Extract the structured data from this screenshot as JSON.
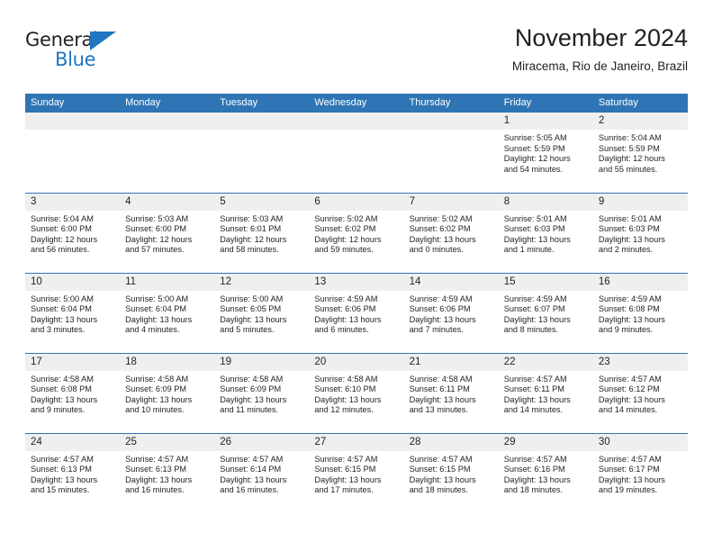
{
  "brand": {
    "name_top": "General",
    "name_bottom": "Blue",
    "accent_color": "#1f76c2"
  },
  "header": {
    "title": "November 2024",
    "subtitle": "Miracema, Rio de Janeiro, Brazil"
  },
  "theme": {
    "header_blue": "#2f75b5",
    "daynum_gray": "#efefef",
    "text": "#231f20"
  },
  "weekday_headers": [
    "Sunday",
    "Monday",
    "Tuesday",
    "Wednesday",
    "Thursday",
    "Friday",
    "Saturday"
  ],
  "weeks": [
    [
      {
        "day": "",
        "lines": []
      },
      {
        "day": "",
        "lines": []
      },
      {
        "day": "",
        "lines": []
      },
      {
        "day": "",
        "lines": []
      },
      {
        "day": "",
        "lines": []
      },
      {
        "day": "1",
        "lines": [
          "Sunrise: 5:05 AM",
          "Sunset: 5:59 PM",
          "Daylight: 12 hours",
          "and 54 minutes."
        ]
      },
      {
        "day": "2",
        "lines": [
          "Sunrise: 5:04 AM",
          "Sunset: 5:59 PM",
          "Daylight: 12 hours",
          "and 55 minutes."
        ]
      }
    ],
    [
      {
        "day": "3",
        "lines": [
          "Sunrise: 5:04 AM",
          "Sunset: 6:00 PM",
          "Daylight: 12 hours",
          "and 56 minutes."
        ]
      },
      {
        "day": "4",
        "lines": [
          "Sunrise: 5:03 AM",
          "Sunset: 6:00 PM",
          "Daylight: 12 hours",
          "and 57 minutes."
        ]
      },
      {
        "day": "5",
        "lines": [
          "Sunrise: 5:03 AM",
          "Sunset: 6:01 PM",
          "Daylight: 12 hours",
          "and 58 minutes."
        ]
      },
      {
        "day": "6",
        "lines": [
          "Sunrise: 5:02 AM",
          "Sunset: 6:02 PM",
          "Daylight: 12 hours",
          "and 59 minutes."
        ]
      },
      {
        "day": "7",
        "lines": [
          "Sunrise: 5:02 AM",
          "Sunset: 6:02 PM",
          "Daylight: 13 hours",
          "and 0 minutes."
        ]
      },
      {
        "day": "8",
        "lines": [
          "Sunrise: 5:01 AM",
          "Sunset: 6:03 PM",
          "Daylight: 13 hours",
          "and 1 minute."
        ]
      },
      {
        "day": "9",
        "lines": [
          "Sunrise: 5:01 AM",
          "Sunset: 6:03 PM",
          "Daylight: 13 hours",
          "and 2 minutes."
        ]
      }
    ],
    [
      {
        "day": "10",
        "lines": [
          "Sunrise: 5:00 AM",
          "Sunset: 6:04 PM",
          "Daylight: 13 hours",
          "and 3 minutes."
        ]
      },
      {
        "day": "11",
        "lines": [
          "Sunrise: 5:00 AM",
          "Sunset: 6:04 PM",
          "Daylight: 13 hours",
          "and 4 minutes."
        ]
      },
      {
        "day": "12",
        "lines": [
          "Sunrise: 5:00 AM",
          "Sunset: 6:05 PM",
          "Daylight: 13 hours",
          "and 5 minutes."
        ]
      },
      {
        "day": "13",
        "lines": [
          "Sunrise: 4:59 AM",
          "Sunset: 6:06 PM",
          "Daylight: 13 hours",
          "and 6 minutes."
        ]
      },
      {
        "day": "14",
        "lines": [
          "Sunrise: 4:59 AM",
          "Sunset: 6:06 PM",
          "Daylight: 13 hours",
          "and 7 minutes."
        ]
      },
      {
        "day": "15",
        "lines": [
          "Sunrise: 4:59 AM",
          "Sunset: 6:07 PM",
          "Daylight: 13 hours",
          "and 8 minutes."
        ]
      },
      {
        "day": "16",
        "lines": [
          "Sunrise: 4:59 AM",
          "Sunset: 6:08 PM",
          "Daylight: 13 hours",
          "and 9 minutes."
        ]
      }
    ],
    [
      {
        "day": "17",
        "lines": [
          "Sunrise: 4:58 AM",
          "Sunset: 6:08 PM",
          "Daylight: 13 hours",
          "and 9 minutes."
        ]
      },
      {
        "day": "18",
        "lines": [
          "Sunrise: 4:58 AM",
          "Sunset: 6:09 PM",
          "Daylight: 13 hours",
          "and 10 minutes."
        ]
      },
      {
        "day": "19",
        "lines": [
          "Sunrise: 4:58 AM",
          "Sunset: 6:09 PM",
          "Daylight: 13 hours",
          "and 11 minutes."
        ]
      },
      {
        "day": "20",
        "lines": [
          "Sunrise: 4:58 AM",
          "Sunset: 6:10 PM",
          "Daylight: 13 hours",
          "and 12 minutes."
        ]
      },
      {
        "day": "21",
        "lines": [
          "Sunrise: 4:58 AM",
          "Sunset: 6:11 PM",
          "Daylight: 13 hours",
          "and 13 minutes."
        ]
      },
      {
        "day": "22",
        "lines": [
          "Sunrise: 4:57 AM",
          "Sunset: 6:11 PM",
          "Daylight: 13 hours",
          "and 14 minutes."
        ]
      },
      {
        "day": "23",
        "lines": [
          "Sunrise: 4:57 AM",
          "Sunset: 6:12 PM",
          "Daylight: 13 hours",
          "and 14 minutes."
        ]
      }
    ],
    [
      {
        "day": "24",
        "lines": [
          "Sunrise: 4:57 AM",
          "Sunset: 6:13 PM",
          "Daylight: 13 hours",
          "and 15 minutes."
        ]
      },
      {
        "day": "25",
        "lines": [
          "Sunrise: 4:57 AM",
          "Sunset: 6:13 PM",
          "Daylight: 13 hours",
          "and 16 minutes."
        ]
      },
      {
        "day": "26",
        "lines": [
          "Sunrise: 4:57 AM",
          "Sunset: 6:14 PM",
          "Daylight: 13 hours",
          "and 16 minutes."
        ]
      },
      {
        "day": "27",
        "lines": [
          "Sunrise: 4:57 AM",
          "Sunset: 6:15 PM",
          "Daylight: 13 hours",
          "and 17 minutes."
        ]
      },
      {
        "day": "28",
        "lines": [
          "Sunrise: 4:57 AM",
          "Sunset: 6:15 PM",
          "Daylight: 13 hours",
          "and 18 minutes."
        ]
      },
      {
        "day": "29",
        "lines": [
          "Sunrise: 4:57 AM",
          "Sunset: 6:16 PM",
          "Daylight: 13 hours",
          "and 18 minutes."
        ]
      },
      {
        "day": "30",
        "lines": [
          "Sunrise: 4:57 AM",
          "Sunset: 6:17 PM",
          "Daylight: 13 hours",
          "and 19 minutes."
        ]
      }
    ]
  ]
}
